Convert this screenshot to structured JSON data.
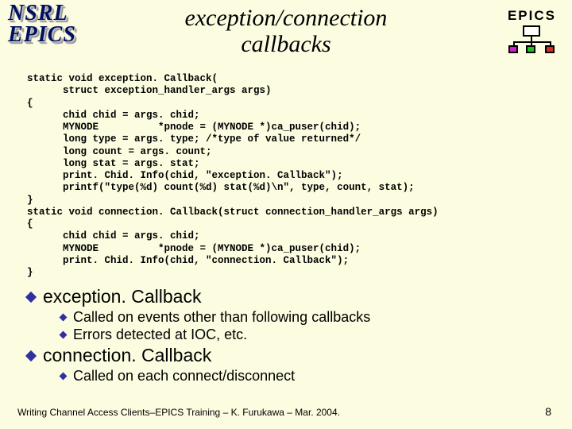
{
  "logo": {
    "line1": "NSRL",
    "line2": "EPICS"
  },
  "title": "exception/connection\ncallbacks",
  "epics_label": "EPICS",
  "code": "static void exception. Callback(\n      struct exception_handler_args args)\n{\n      chid chid = args. chid;\n      MYNODE          *pnode = (MYNODE *)ca_puser(chid);\n      long type = args. type; /*type of value returned*/\n      long count = args. count;\n      long stat = args. stat;\n      print. Chid. Info(chid, \"exception. Callback\");\n      printf(\"type(%d) count(%d) stat(%d)\\n\", type, count, stat);\n}\nstatic void connection. Callback(struct connection_handler_args args)\n{\n      chid chid = args. chid;\n      MYNODE          *pnode = (MYNODE *)ca_puser(chid);\n      print. Chid. Info(chid, \"connection. Callback\");\n}",
  "bullets": {
    "b1a": "exception. Callback",
    "b2a": "Called on events other than following callbacks",
    "b2b": "Errors detected at IOC, etc.",
    "b1b": "connection. Callback",
    "b2c": "Called on each connect/disconnect"
  },
  "footer": "Writing Channel Access Clients–EPICS Training – K. Furukawa – Mar. 2004.",
  "pagenum": "8"
}
